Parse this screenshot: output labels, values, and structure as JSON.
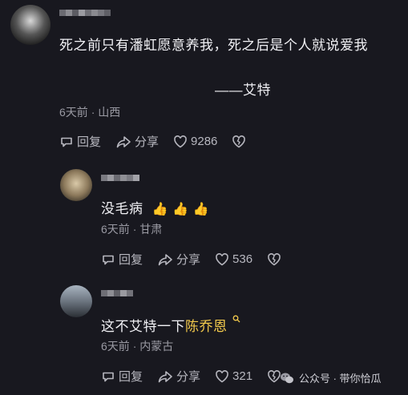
{
  "comment_main": {
    "text": "死之前只有潘虹愿意养我，死之后是个人就说爱我",
    "signature": "——艾特",
    "time": "6天前",
    "location": "山西",
    "reply_label": "回复",
    "share_label": "分享",
    "like_count": "9286"
  },
  "reply_1": {
    "text": "没毛病",
    "emojis": "👍 👍 👍",
    "time": "6天前",
    "location": "甘肃",
    "reply_label": "回复",
    "share_label": "分享",
    "like_count": "536"
  },
  "reply_2": {
    "text_prefix": "这不艾特一下",
    "mention": "陈乔恩",
    "time": "6天前",
    "location": "内蒙古",
    "reply_label": "回复",
    "share_label": "分享",
    "like_count": "321"
  },
  "watermark": {
    "text": "公众号 · 带你恰瓜"
  },
  "colors": {
    "background": "#18181f",
    "mention": "#f2c94c",
    "meta": "#9a9aa3"
  }
}
